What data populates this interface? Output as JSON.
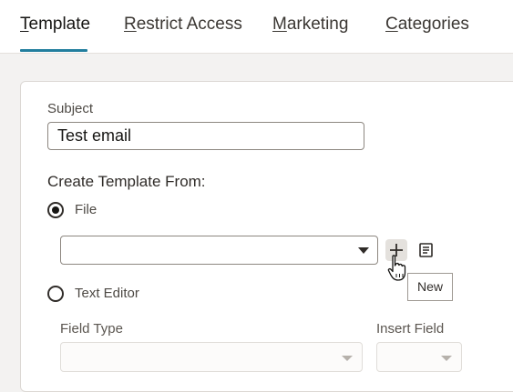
{
  "tabs": [
    {
      "mnemonic": "T",
      "rest": "emplate",
      "active": true
    },
    {
      "mnemonic": "R",
      "rest": "estrict Access",
      "active": false
    },
    {
      "mnemonic": "M",
      "rest": "arketing",
      "active": false
    },
    {
      "mnemonic": "C",
      "rest": "ategories",
      "active": false
    }
  ],
  "form": {
    "subject_label": "Subject",
    "subject_value": "Test email",
    "create_from_label": "Create Template From:",
    "file_option": {
      "label": "File",
      "selected": true
    },
    "file_select_value": "",
    "text_editor_option": {
      "label": "Text Editor",
      "selected": false
    },
    "field_type_label": "Field Type",
    "insert_field_label": "Insert Field"
  },
  "actions": {
    "new_icon": "plus-icon",
    "details_icon": "document-icon"
  },
  "tooltip": {
    "text": "New"
  },
  "colors": {
    "accent": "#227e9e",
    "page_background": "#f3f2f1",
    "panel_background": "#ffffff",
    "text": "#312d2a"
  }
}
